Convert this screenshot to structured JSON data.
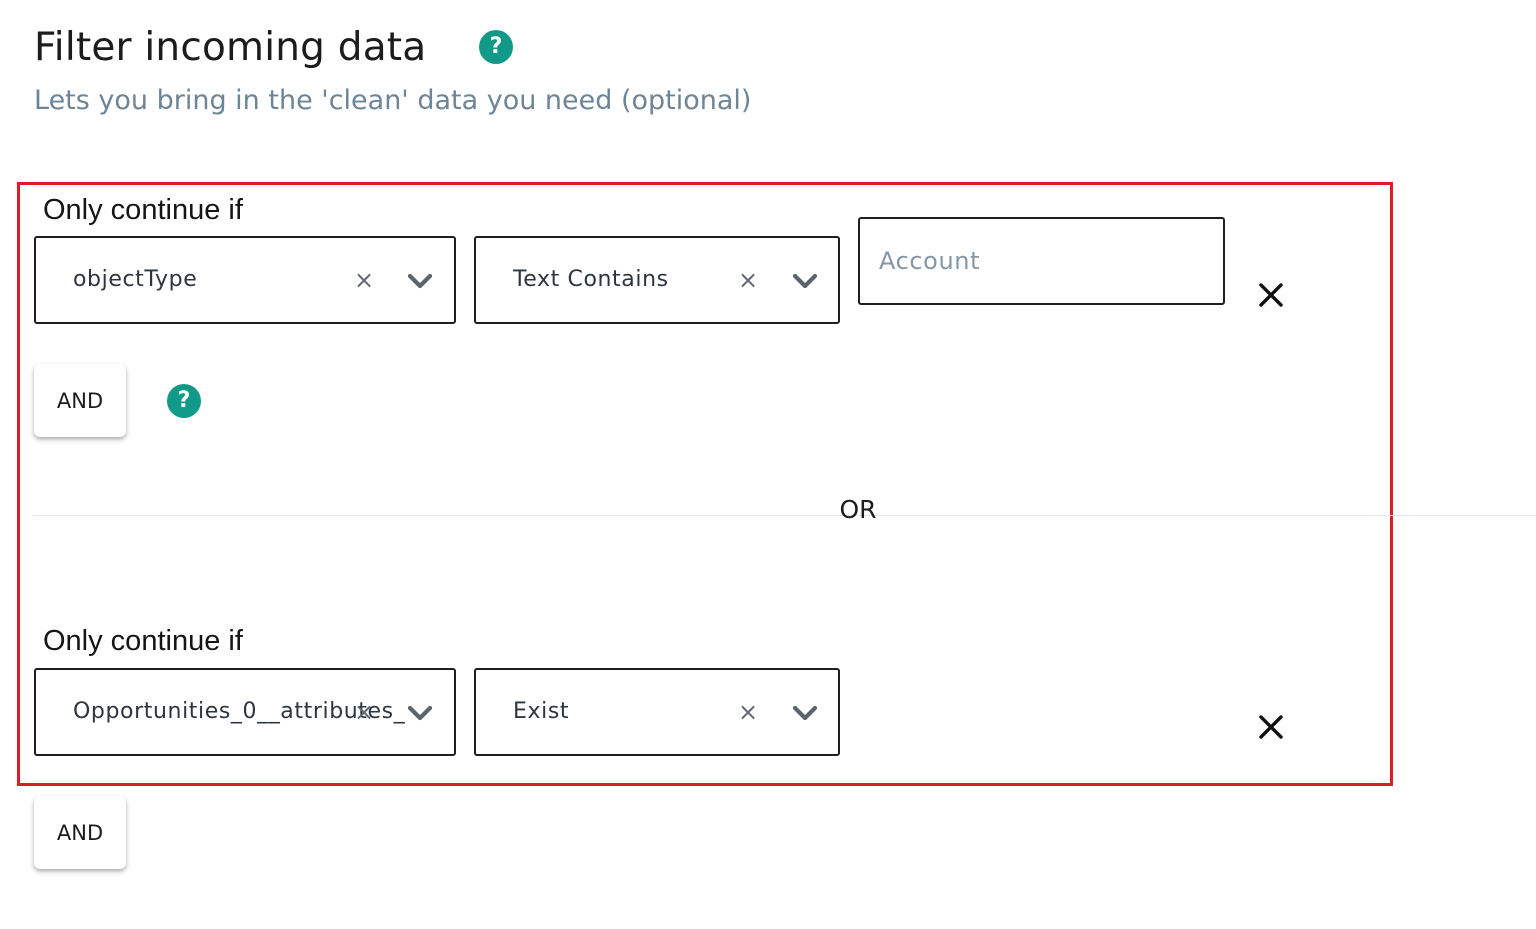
{
  "header": {
    "title": "Filter incoming data",
    "subtitle": "Lets you bring in the 'clean' data you need (optional)",
    "help_icon": "?"
  },
  "filter_groups": [
    {
      "label": "Only continue if",
      "field": "objectType",
      "operator": "Text Contains",
      "value_placeholder": "Account",
      "clear_glyph": "×"
    },
    {
      "label": "Only continue if",
      "field": "Opportunities_0__attributes_",
      "operator": "Exist",
      "clear_glyph": "×"
    }
  ],
  "and_label": "AND",
  "or_label": "OR",
  "colors": {
    "accent": "#129a88",
    "highlight_border": "#e01b24",
    "subtitle": "#6e8497"
  },
  "icons": [
    "help-icon",
    "clear-icon",
    "chevron-down-icon",
    "close-icon"
  ]
}
